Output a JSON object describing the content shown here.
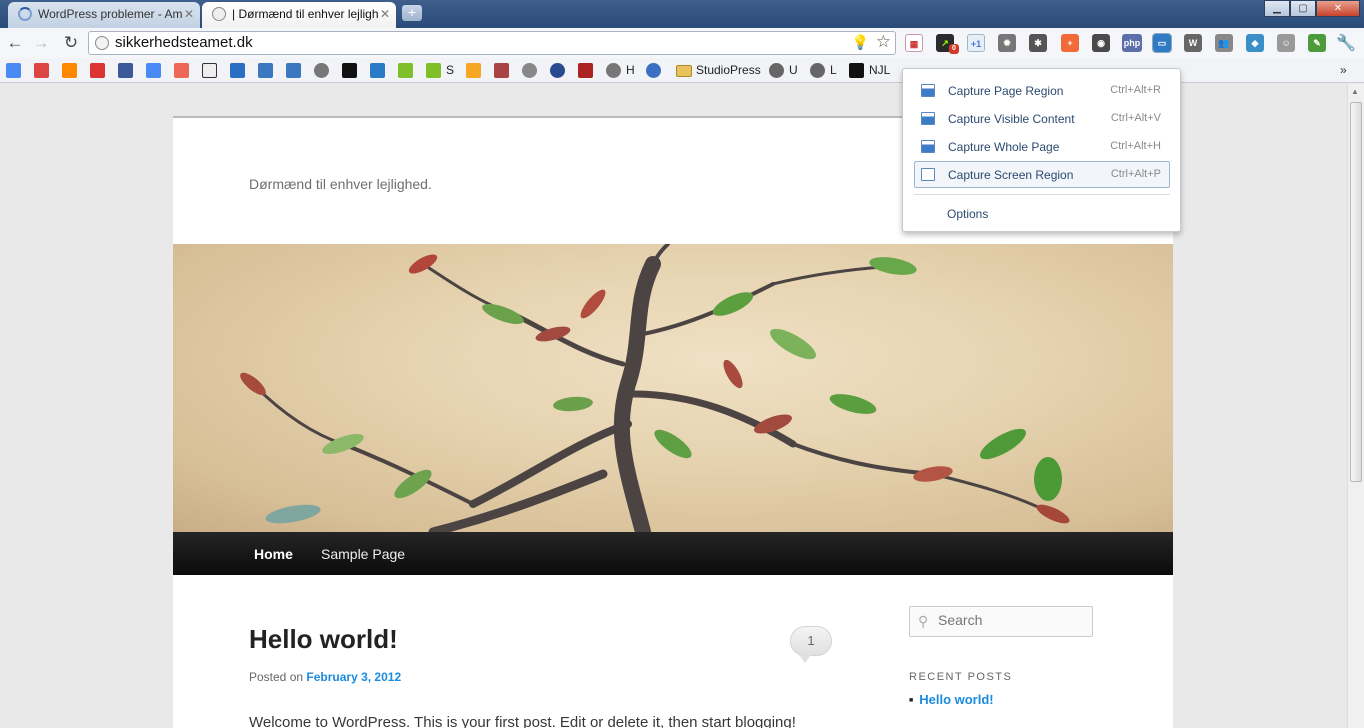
{
  "browser": {
    "tabs": [
      {
        "title": "WordPress problemer - Am",
        "active": false
      },
      {
        "title": "| Dørmænd til enhver lejligh",
        "active": true
      }
    ],
    "address": "sikkerhedsteamet.dk",
    "bookmarks": [
      {
        "label": "S"
      },
      {
        "label": "H"
      },
      {
        "label": "StudioPress"
      },
      {
        "label": "U"
      },
      {
        "label": "L"
      },
      {
        "label": "NJL"
      }
    ],
    "extension_icons": [
      {
        "name": "php-icon",
        "text": "php",
        "color": "#5b6fa8"
      },
      {
        "name": "google-plus-one-icon",
        "text": "+1",
        "color": "#3a79d8"
      },
      {
        "name": "badge-count",
        "text": "0",
        "color": "#d23b2a"
      }
    ]
  },
  "capture_menu": {
    "items": [
      {
        "label": "Capture Page Region",
        "shortcut": "Ctrl+Alt+R"
      },
      {
        "label": "Capture Visible Content",
        "shortcut": "Ctrl+Alt+V"
      },
      {
        "label": "Capture Whole Page",
        "shortcut": "Ctrl+Alt+H"
      },
      {
        "label": "Capture Screen Region",
        "shortcut": "Ctrl+Alt+P"
      }
    ],
    "options_label": "Options"
  },
  "site": {
    "tagline": "Dørmænd til enhver lejlighed.",
    "nav": [
      {
        "label": "Home",
        "current": true
      },
      {
        "label": "Sample Page",
        "current": false
      }
    ],
    "post": {
      "title": "Hello world!",
      "comment_count": "1",
      "posted_prefix": "Posted on",
      "date": "February 3, 2012",
      "excerpt": "Welcome to WordPress. This is your first post. Edit or delete it, then start blogging!"
    },
    "sidebar": {
      "search_placeholder": "Search",
      "recent_posts_title": "RECENT POSTS",
      "recent_posts": [
        "Hello world!"
      ]
    }
  },
  "colors": {
    "link": "#1b8be0",
    "nav_bar": "#111111",
    "popup_text": "#2a4a70"
  }
}
